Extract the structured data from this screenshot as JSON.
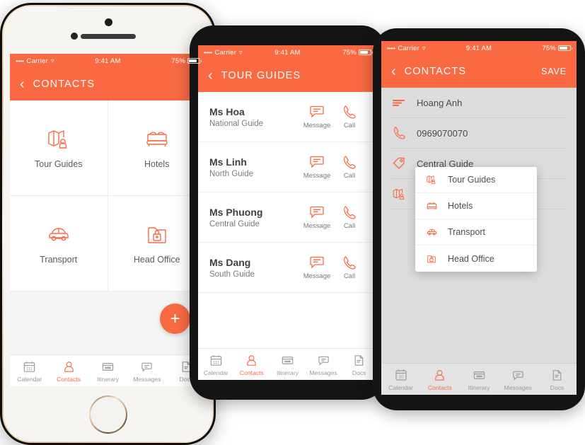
{
  "theme": {
    "accent": "#F96A43",
    "text_dark": "#3f3f3f",
    "text_muted": "#7a7a7a",
    "screen_gray": "#dcdcdc"
  },
  "status_bar": {
    "carrier": "Carrier",
    "dots": "•••••",
    "time": "9:41 AM",
    "battery": "75%"
  },
  "tabs": [
    {
      "label": "Calendar",
      "icon": "calendar-icon",
      "active": false
    },
    {
      "label": "Contacts",
      "icon": "contacts-icon",
      "active": true
    },
    {
      "label": "Itinerary",
      "icon": "itinerary-icon",
      "active": false
    },
    {
      "label": "Messages",
      "icon": "messages-icon",
      "active": false
    },
    {
      "label": "Docs",
      "icon": "docs-icon",
      "active": false
    }
  ],
  "phone1": {
    "nav": {
      "back": "‹",
      "title": "CONTACTS"
    },
    "grid": [
      {
        "label": "Tour Guides",
        "icon": "map-guide-icon"
      },
      {
        "label": "Hotels",
        "icon": "bed-icon"
      },
      {
        "label": "Transport",
        "icon": "car-icon"
      },
      {
        "label": "Head Office",
        "icon": "folder-lock-icon"
      }
    ],
    "fab": {
      "label": "+",
      "icon": "plus-icon"
    }
  },
  "phone2": {
    "nav": {
      "back": "‹",
      "title": "TOUR GUIDES"
    },
    "actions": {
      "message": "Message",
      "call": "Call"
    },
    "contacts": [
      {
        "name": "Ms Hoa",
        "role": "National Guide"
      },
      {
        "name": "Ms Linh",
        "role": "North Guide"
      },
      {
        "name": "Ms Phuong",
        "role": "Central Guide"
      },
      {
        "name": "Ms Dang",
        "role": "South Guide"
      }
    ]
  },
  "phone3": {
    "nav": {
      "back": "‹",
      "title": "CONTACTS",
      "save": "SAVE"
    },
    "fields": [
      {
        "icon": "name-lines-icon",
        "value": "Hoang Anh"
      },
      {
        "icon": "phone-icon",
        "value": "0969070070"
      },
      {
        "icon": "tag-icon",
        "value": "Central Guide"
      },
      {
        "icon": "map-guide-icon",
        "value": ""
      }
    ],
    "dropdown": [
      {
        "label": "Tour Guides",
        "icon": "map-guide-icon"
      },
      {
        "label": "Hotels",
        "icon": "bed-icon"
      },
      {
        "label": "Transport",
        "icon": "car-icon"
      },
      {
        "label": "Head Office",
        "icon": "folder-lock-icon"
      }
    ]
  }
}
